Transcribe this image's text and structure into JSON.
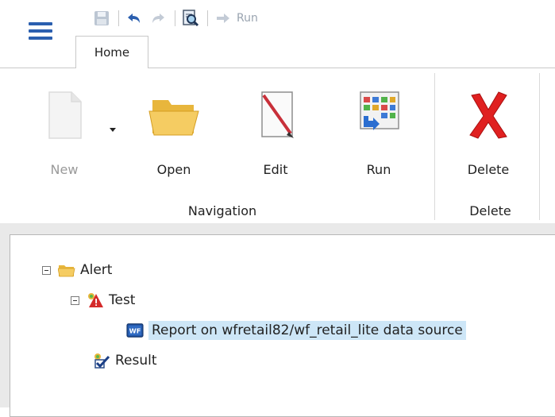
{
  "toolbar": {
    "quick_access": {
      "run_label": "Run"
    },
    "tabs": [
      {
        "label": "Home"
      }
    ]
  },
  "ribbon": {
    "buttons": [
      {
        "label": "New",
        "enabled": false,
        "icon": "new-document-icon"
      },
      {
        "label": "Open",
        "enabled": true,
        "icon": "folder-open-icon"
      },
      {
        "label": "Edit",
        "enabled": true,
        "icon": "edit-document-icon"
      },
      {
        "label": "Run",
        "enabled": true,
        "icon": "run-report-icon"
      },
      {
        "label": "Delete",
        "enabled": true,
        "icon": "delete-x-icon"
      }
    ],
    "groups": [
      {
        "label": "Navigation"
      },
      {
        "label": "Delete"
      }
    ]
  },
  "tree": {
    "root": {
      "label": "Alert",
      "icon": "folder-icon",
      "expanded": true
    },
    "test": {
      "label": "Test",
      "icon": "alert-test-icon",
      "expanded": true
    },
    "report": {
      "label": "Report on wfretail82/wf_retail_lite data source",
      "icon": "wf-report-icon",
      "selected": true
    },
    "result": {
      "label": "Result",
      "icon": "alert-result-icon"
    }
  },
  "colors": {
    "accent": "#2b5faf",
    "selection": "#cde6f7",
    "delete_red": "#e02020"
  }
}
